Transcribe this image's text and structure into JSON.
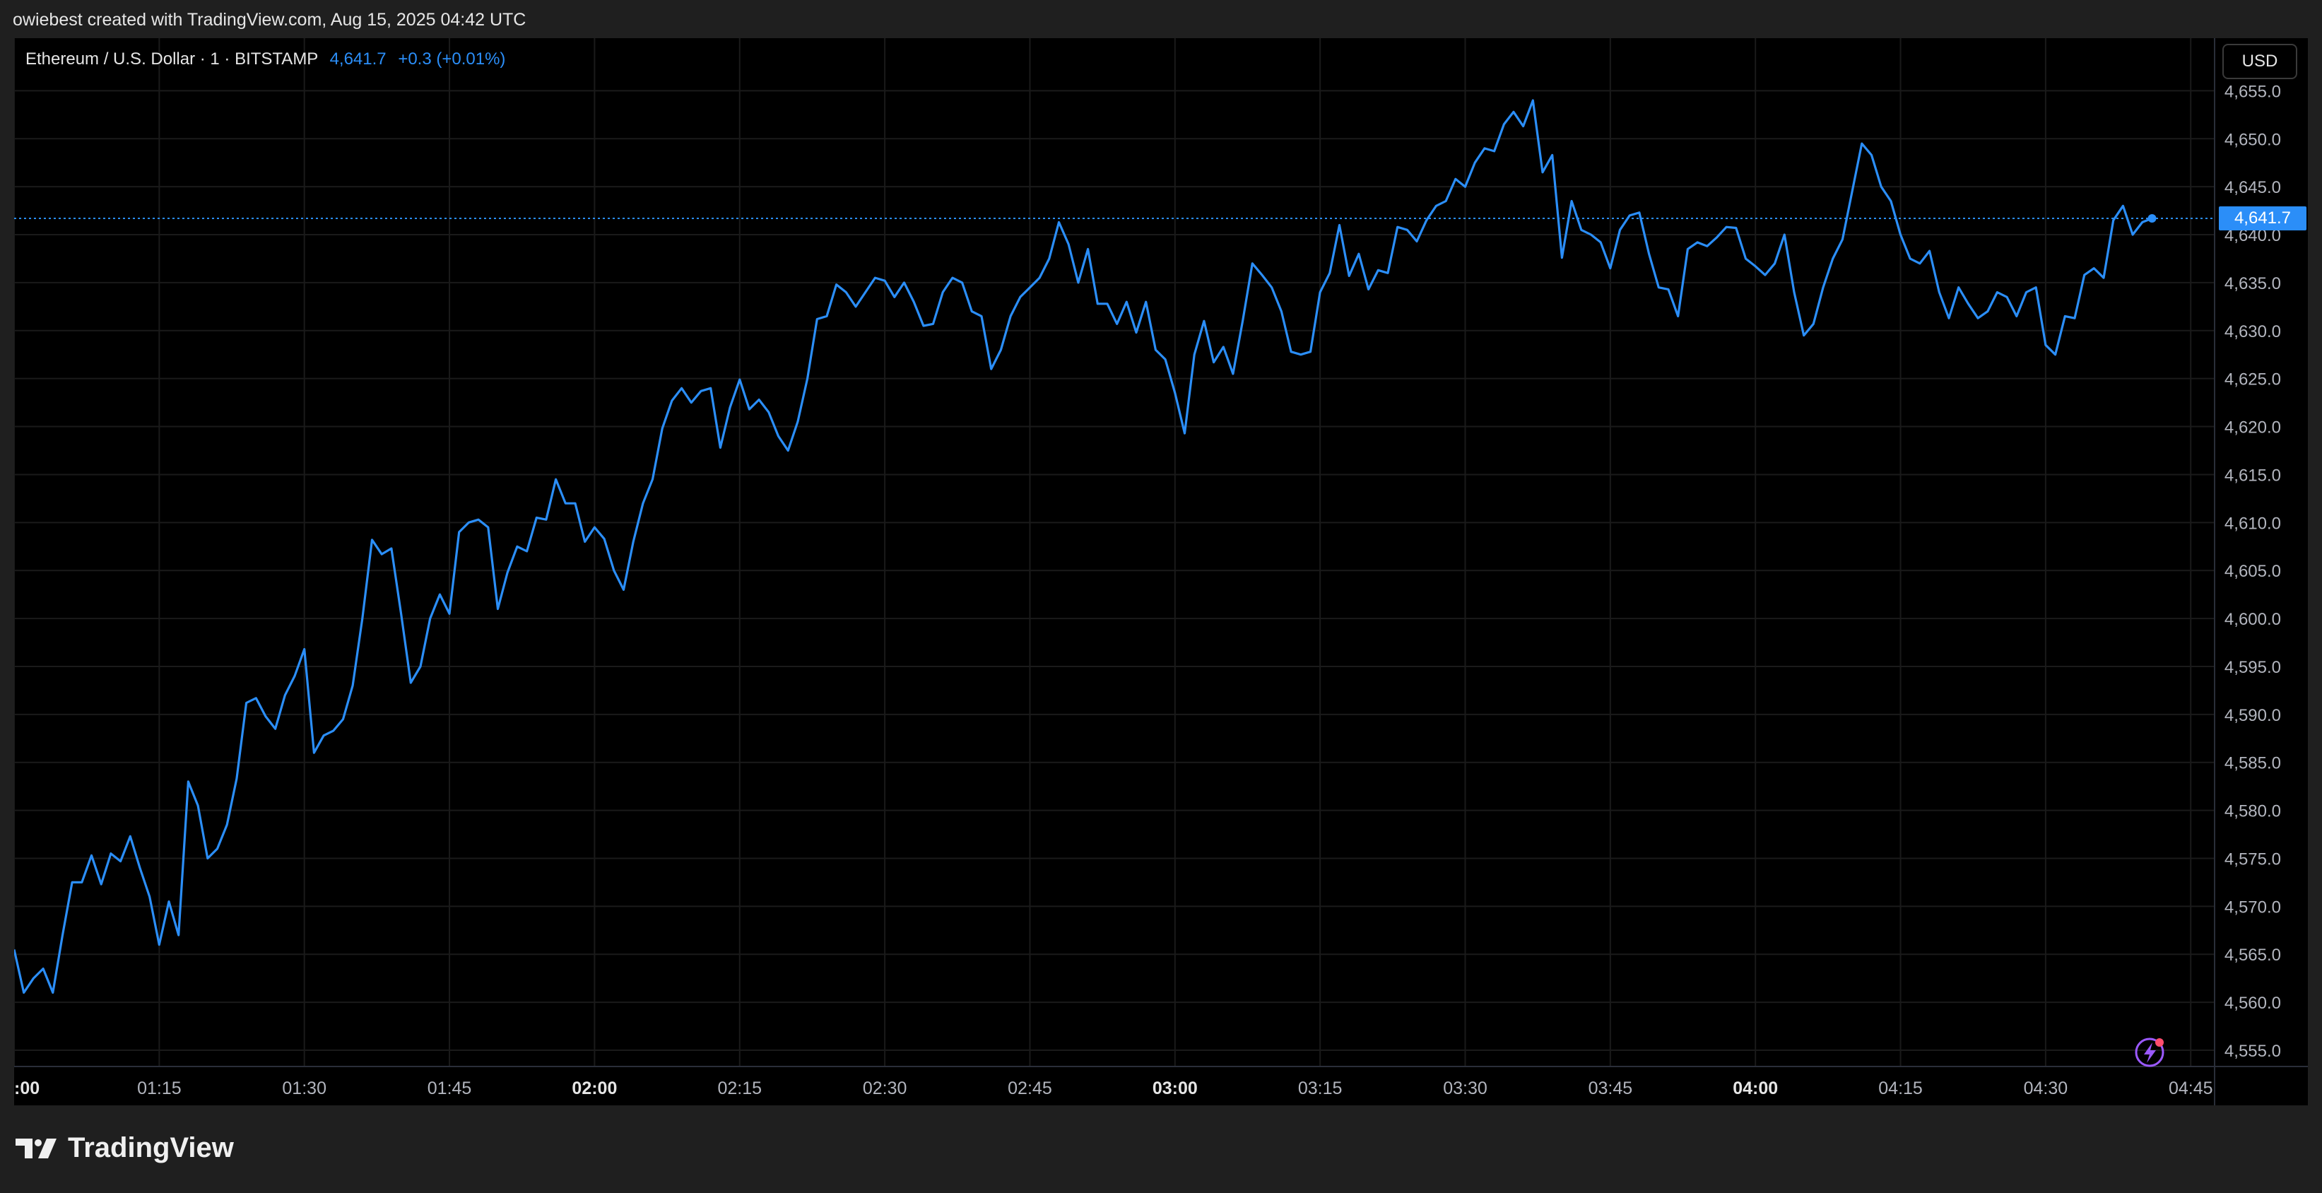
{
  "header": {
    "created_text": "owiebest created with TradingView.com, Aug 15, 2025 04:42 UTC"
  },
  "legend": {
    "symbol": "Ethereum / U.S. Dollar · 1 · BITSTAMP",
    "price": "4,641.7",
    "change": "+0.3 (+0.01%)"
  },
  "currency_button": "USD",
  "last_price_label": "4,641.7",
  "footer": {
    "brand": "TradingView"
  },
  "colors": {
    "line": "#2b8ef8",
    "background": "#000000",
    "grid": "#1a1a1a",
    "axis_text": "#b2b5be"
  },
  "chart_data": {
    "type": "line",
    "title": "Ethereum / U.S. Dollar · 1 · BITSTAMP",
    "y_axis_side": "right",
    "ylim": [
      4553.0,
      4657.0
    ],
    "y_ticks": [
      4555.0,
      4560.0,
      4565.0,
      4570.0,
      4575.0,
      4580.0,
      4585.0,
      4590.0,
      4595.0,
      4600.0,
      4605.0,
      4610.0,
      4615.0,
      4620.0,
      4625.0,
      4630.0,
      4635.0,
      4640.0,
      4645.0,
      4650.0,
      4655.0
    ],
    "y_tick_labels": [
      "4,555.0",
      "4,560.0",
      "4,565.0",
      "4,570.0",
      "4,575.0",
      "4,580.0",
      "4,585.0",
      "4,590.0",
      "4,595.0",
      "4,600.0",
      "4,605.0",
      "4,610.0",
      "4,615.0",
      "4,620.0",
      "4,625.0",
      "4,630.0",
      "4,635.0",
      "4,640.0",
      "4,645.0",
      "4,650.0",
      "4,655.0"
    ],
    "xlim": [
      60,
      286
    ],
    "x_ticks": [
      {
        "label": ":00",
        "minute": 60,
        "bold": true
      },
      {
        "label": "01:15",
        "minute": 75,
        "bold": false
      },
      {
        "label": "01:30",
        "minute": 90,
        "bold": false
      },
      {
        "label": "01:45",
        "minute": 105,
        "bold": false
      },
      {
        "label": "02:00",
        "minute": 120,
        "bold": true
      },
      {
        "label": "02:15",
        "minute": 135,
        "bold": false
      },
      {
        "label": "02:30",
        "minute": 150,
        "bold": false
      },
      {
        "label": "02:45",
        "minute": 165,
        "bold": false
      },
      {
        "label": "03:00",
        "minute": 180,
        "bold": true
      },
      {
        "label": "03:15",
        "minute": 195,
        "bold": false
      },
      {
        "label": "03:30",
        "minute": 210,
        "bold": false
      },
      {
        "label": "03:45",
        "minute": 225,
        "bold": false
      },
      {
        "label": "04:00",
        "minute": 240,
        "bold": true
      },
      {
        "label": "04:15",
        "minute": 255,
        "bold": false
      },
      {
        "label": "04:30",
        "minute": 270,
        "bold": false
      },
      {
        "label": "04:45",
        "minute": 285,
        "bold": false
      }
    ],
    "last_price": 4641.7,
    "series": [
      {
        "color": "#2b8ef8",
        "x_unit": "minutes after 00:00 UTC",
        "points": [
          [
            60,
            4565.5
          ],
          [
            61,
            4561.0
          ],
          [
            62,
            4562.5
          ],
          [
            63,
            4563.5
          ],
          [
            64,
            4561.0
          ],
          [
            65,
            4567.0
          ],
          [
            66,
            4572.5
          ],
          [
            67,
            4572.5
          ],
          [
            68,
            4575.3
          ],
          [
            69,
            4572.3
          ],
          [
            70,
            4575.5
          ],
          [
            71,
            4574.7
          ],
          [
            72,
            4577.3
          ],
          [
            73,
            4574.0
          ],
          [
            74,
            4571.0
          ],
          [
            75,
            4566.0
          ],
          [
            76,
            4570.5
          ],
          [
            77,
            4567.0
          ],
          [
            78,
            4583.0
          ],
          [
            79,
            4580.5
          ],
          [
            80,
            4575.0
          ],
          [
            81,
            4576.0
          ],
          [
            82,
            4578.5
          ],
          [
            83,
            4583.3
          ],
          [
            84,
            4591.2
          ],
          [
            85,
            4591.7
          ],
          [
            86,
            4589.8
          ],
          [
            87,
            4588.5
          ],
          [
            88,
            4592.0
          ],
          [
            89,
            4594.0
          ],
          [
            90,
            4596.8
          ],
          [
            91,
            4586.0
          ],
          [
            92,
            4587.8
          ],
          [
            93,
            4588.3
          ],
          [
            94,
            4589.5
          ],
          [
            95,
            4593.0
          ],
          [
            96,
            4600.0
          ],
          [
            97,
            4608.2
          ],
          [
            98,
            4606.7
          ],
          [
            99,
            4607.3
          ],
          [
            100,
            4600.5
          ],
          [
            101,
            4593.3
          ],
          [
            102,
            4595.0
          ],
          [
            103,
            4600.0
          ],
          [
            104,
            4602.5
          ],
          [
            105,
            4600.5
          ],
          [
            106,
            4609.0
          ],
          [
            107,
            4610.0
          ],
          [
            108,
            4610.3
          ],
          [
            109,
            4609.5
          ],
          [
            110,
            4601.0
          ],
          [
            111,
            4604.8
          ],
          [
            112,
            4607.5
          ],
          [
            113,
            4607.0
          ],
          [
            114,
            4610.5
          ],
          [
            115,
            4610.3
          ],
          [
            116,
            4614.5
          ],
          [
            117,
            4612.0
          ],
          [
            118,
            4612.0
          ],
          [
            119,
            4608.0
          ],
          [
            120,
            4609.5
          ],
          [
            121,
            4608.3
          ],
          [
            122,
            4605.0
          ],
          [
            123,
            4603.0
          ],
          [
            124,
            4608.0
          ],
          [
            125,
            4612.0
          ],
          [
            126,
            4614.5
          ],
          [
            127,
            4619.8
          ],
          [
            128,
            4622.7
          ],
          [
            129,
            4624.0
          ],
          [
            130,
            4622.5
          ],
          [
            131,
            4623.7
          ],
          [
            132,
            4624.0
          ],
          [
            133,
            4617.8
          ],
          [
            134,
            4622.0
          ],
          [
            135,
            4624.9
          ],
          [
            136,
            4621.8
          ],
          [
            137,
            4622.8
          ],
          [
            138,
            4621.5
          ],
          [
            139,
            4619.0
          ],
          [
            140,
            4617.5
          ],
          [
            141,
            4620.5
          ],
          [
            142,
            4625.0
          ],
          [
            143,
            4631.2
          ],
          [
            144,
            4631.5
          ],
          [
            145,
            4634.8
          ],
          [
            146,
            4634.0
          ],
          [
            147,
            4632.5
          ],
          [
            148,
            4634.0
          ],
          [
            149,
            4635.5
          ],
          [
            150,
            4635.2
          ],
          [
            151,
            4633.5
          ],
          [
            152,
            4635.0
          ],
          [
            153,
            4633.0
          ],
          [
            154,
            4630.5
          ],
          [
            155,
            4630.7
          ],
          [
            156,
            4634.0
          ],
          [
            157,
            4635.5
          ],
          [
            158,
            4635.0
          ],
          [
            159,
            4632.0
          ],
          [
            160,
            4631.5
          ],
          [
            161,
            4626.0
          ],
          [
            162,
            4628.0
          ],
          [
            163,
            4631.5
          ],
          [
            164,
            4633.5
          ],
          [
            165,
            4634.5
          ],
          [
            166,
            4635.5
          ],
          [
            167,
            4637.5
          ],
          [
            168,
            4641.3
          ],
          [
            169,
            4639.0
          ],
          [
            170,
            4635.0
          ],
          [
            171,
            4638.5
          ],
          [
            172,
            4632.8
          ],
          [
            173,
            4632.8
          ],
          [
            174,
            4630.7
          ],
          [
            175,
            4633.0
          ],
          [
            176,
            4629.8
          ],
          [
            177,
            4633.0
          ],
          [
            178,
            4628.0
          ],
          [
            179,
            4627.0
          ],
          [
            180,
            4623.5
          ],
          [
            181,
            4619.3
          ],
          [
            182,
            4627.5
          ],
          [
            183,
            4631.0
          ],
          [
            184,
            4626.7
          ],
          [
            185,
            4628.3
          ],
          [
            186,
            4625.5
          ],
          [
            187,
            4631.0
          ],
          [
            188,
            4637.0
          ],
          [
            189,
            4635.8
          ],
          [
            190,
            4634.5
          ],
          [
            191,
            4632.0
          ],
          [
            192,
            4627.8
          ],
          [
            193,
            4627.5
          ],
          [
            194,
            4627.8
          ],
          [
            195,
            4634.0
          ],
          [
            196,
            4636.0
          ],
          [
            197,
            4641.0
          ],
          [
            198,
            4635.7
          ],
          [
            199,
            4638.0
          ],
          [
            200,
            4634.3
          ],
          [
            201,
            4636.3
          ],
          [
            202,
            4636.0
          ],
          [
            203,
            4640.8
          ],
          [
            204,
            4640.5
          ],
          [
            205,
            4639.3
          ],
          [
            206,
            4641.5
          ],
          [
            207,
            4643.0
          ],
          [
            208,
            4643.5
          ],
          [
            209,
            4645.8
          ],
          [
            210,
            4645.0
          ],
          [
            211,
            4647.5
          ],
          [
            212,
            4649.0
          ],
          [
            213,
            4648.7
          ],
          [
            214,
            4651.5
          ],
          [
            215,
            4652.8
          ],
          [
            216,
            4651.3
          ],
          [
            217,
            4654.0
          ],
          [
            218,
            4646.5
          ],
          [
            219,
            4648.3
          ],
          [
            220,
            4637.6
          ],
          [
            221,
            4643.5
          ],
          [
            222,
            4640.5
          ],
          [
            223,
            4640.0
          ],
          [
            224,
            4639.2
          ],
          [
            225,
            4636.5
          ],
          [
            226,
            4640.5
          ],
          [
            227,
            4642.0
          ],
          [
            228,
            4642.3
          ],
          [
            229,
            4638.0
          ],
          [
            230,
            4634.5
          ],
          [
            231,
            4634.3
          ],
          [
            232,
            4631.5
          ],
          [
            233,
            4638.5
          ],
          [
            234,
            4639.2
          ],
          [
            235,
            4638.8
          ],
          [
            236,
            4639.7
          ],
          [
            237,
            4640.8
          ],
          [
            238,
            4640.7
          ],
          [
            239,
            4637.5
          ],
          [
            240,
            4636.7
          ],
          [
            241,
            4635.8
          ],
          [
            242,
            4637.0
          ],
          [
            243,
            4640.0
          ],
          [
            244,
            4634.0
          ],
          [
            245,
            4629.5
          ],
          [
            246,
            4630.7
          ],
          [
            247,
            4634.5
          ],
          [
            248,
            4637.5
          ],
          [
            249,
            4639.5
          ],
          [
            250,
            4644.5
          ],
          [
            251,
            4649.5
          ],
          [
            252,
            4648.3
          ],
          [
            253,
            4645.0
          ],
          [
            254,
            4643.5
          ],
          [
            255,
            4640.0
          ],
          [
            256,
            4637.5
          ],
          [
            257,
            4637.0
          ],
          [
            258,
            4638.3
          ],
          [
            259,
            4634.0
          ],
          [
            260,
            4631.3
          ],
          [
            261,
            4634.5
          ],
          [
            262,
            4632.8
          ],
          [
            263,
            4631.3
          ],
          [
            264,
            4632.0
          ],
          [
            265,
            4634.0
          ],
          [
            266,
            4633.5
          ],
          [
            267,
            4631.5
          ],
          [
            268,
            4634.0
          ],
          [
            269,
            4634.5
          ],
          [
            270,
            4628.5
          ],
          [
            271,
            4627.5
          ],
          [
            272,
            4631.5
          ],
          [
            273,
            4631.3
          ],
          [
            274,
            4635.8
          ],
          [
            275,
            4636.5
          ],
          [
            276,
            4635.5
          ],
          [
            277,
            4641.5
          ],
          [
            278,
            4643.0
          ],
          [
            279,
            4640.0
          ],
          [
            280,
            4641.3
          ],
          [
            281,
            4641.7
          ]
        ]
      }
    ]
  }
}
